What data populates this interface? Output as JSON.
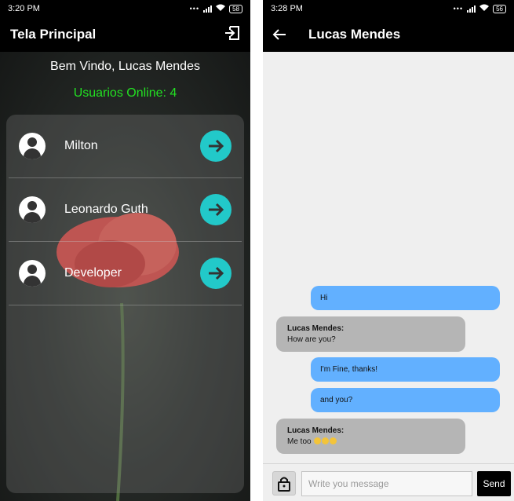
{
  "left": {
    "status": {
      "time": "3:20 PM",
      "battery": "58"
    },
    "appbar": {
      "title": "Tela Principal",
      "logout_icon": "logout-icon"
    },
    "welcome": "Bem Vindo, Lucas Mendes",
    "online": "Usuarios Online: 4",
    "users": [
      {
        "name": "Milton"
      },
      {
        "name": "Leonardo Guth"
      },
      {
        "name": "Developer"
      }
    ],
    "colors": {
      "accent": "#22c9c9",
      "online": "#22e022"
    }
  },
  "right": {
    "status": {
      "time": "3:28 PM",
      "battery": "56"
    },
    "appbar": {
      "title": "Lucas Mendes",
      "back_icon": "arrow-left-icon"
    },
    "messages": [
      {
        "from": "me",
        "text": "Hi"
      },
      {
        "from": "them",
        "sender": "Lucas Mendes:",
        "text": "How are you?"
      },
      {
        "from": "me",
        "text": "I'm Fine, thanks!"
      },
      {
        "from": "me",
        "text": "and you?"
      },
      {
        "from": "them",
        "sender": "Lucas Mendes:",
        "text": "Me too"
      }
    ],
    "composer": {
      "placeholder": "Write you message",
      "send_label": "Send",
      "lock_icon": "lock-icon"
    },
    "colors": {
      "my_bubble": "#62b0ff",
      "their_bubble": "#b5b5b5"
    }
  }
}
